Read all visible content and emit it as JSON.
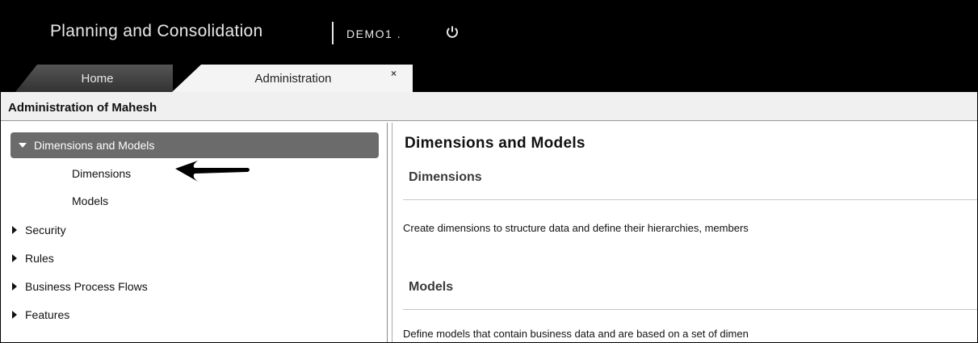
{
  "header": {
    "app_title": "Planning and Consolidation",
    "user": "DEMO1 ."
  },
  "tabs": [
    {
      "label": "Home"
    },
    {
      "label": "Administration",
      "close": "×"
    }
  ],
  "page": {
    "title": "Administration of Mahesh"
  },
  "sidebar": {
    "selected": "Dimensions and Models",
    "sub_items": [
      "Dimensions",
      "Models"
    ],
    "items": [
      "Security",
      "Rules",
      "Business Process Flows",
      "Features"
    ]
  },
  "content": {
    "title": "Dimensions and Models",
    "sections": [
      {
        "heading": "Dimensions",
        "text": "Create dimensions to structure data and define their hierarchies, members"
      },
      {
        "heading": "Models",
        "text": "Define models that contain business data and are based on a set of dimen"
      }
    ]
  }
}
